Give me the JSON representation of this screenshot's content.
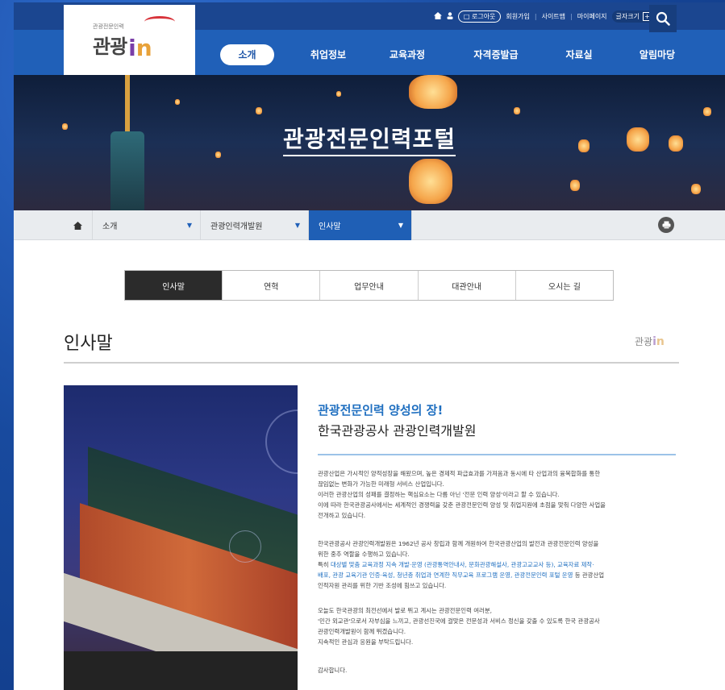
{
  "logo": {
    "small_text": "관광전문인력",
    "korean": "관광",
    "in_i": "i",
    "in_n": "n"
  },
  "util_nav": {
    "home_icon": "home-icon",
    "logout": "로그아웃",
    "join": "회원가입",
    "sitemap": "사이트맵",
    "mypage": "마이페이지",
    "font_size_label": "글자크기",
    "font_plus": "+",
    "font_reset": "o",
    "font_minus": "−"
  },
  "gnb": {
    "items": [
      {
        "label": "소개"
      },
      {
        "label": "취업정보"
      },
      {
        "label": "교육과정"
      },
      {
        "label": "자격증발급"
      },
      {
        "label": "자료실"
      },
      {
        "label": "알림마당"
      }
    ]
  },
  "hero": {
    "title": "관광전문인력포털"
  },
  "breadcrumb": {
    "level1": "소개",
    "level2": "관광인력개발원",
    "level3": "인사말"
  },
  "subtabs": [
    {
      "label": "인사말"
    },
    {
      "label": "연혁"
    },
    {
      "label": "업무안내"
    },
    {
      "label": "대관안내"
    },
    {
      "label": "오시는 길"
    }
  ],
  "page": {
    "title": "인사말",
    "title_logo_kor": "관광"
  },
  "content": {
    "headline1": "관광전문인력 양성의 장!",
    "headline2": "한국관광공사 관광인력개발원",
    "p1": [
      "관광산업은 가시적인 양적성장을 해왔으며, 높은 경제적 파급효과를 가져옴과 동시에 타 산업과의 융복합화를 통한",
      "끊임없는 변화가 가능한 미래형 서비스 산업입니다.",
      "이러한 관광산업의 성패를 결정하는 핵심요소는 다름 아닌 '전문 인력 양성'이라고 할 수 있습니다.",
      "이에 따라 한국관광공사에서는 세계적인 경쟁력을 갖춘 관광전문인력 양성 및 취업지원에 초점을 맞춰 다양한 사업을",
      "전개하고 있습니다."
    ],
    "p2_line1": "한국관광공사 관광인력개발원은 1962년 공사 창립과 함께 개원하여 한국관광산업의 발전과 관광전문인력 양성을",
    "p2_line2": "위한 중추 역할을 수행하고 있습니다.",
    "p2_line3_pre": "특히 ",
    "p2_line3_hl": "대상별 맞춤 교육과정 지속 개발·운영 (관광통역안내사, 문화관광해설사, 관광고교교사 등), 교육자료 제작·",
    "p2_line4_hl": "배포, 관광 교육기관 인증·육성, 청년층 취업과 연계한 직무교육 프로그램 운영, 관광전문인력 포털 운영",
    "p2_line4_post": " 등 관광산업",
    "p2_line5": "인적자원 관리를 위한 기반 조성에 힘쓰고 있습니다.",
    "p3": [
      "오늘도 한국관광의 최전선에서 발로 뛰고 계시는 관광전문인력 여러분,",
      "'민간 외교관'으로서 자부심을 느끼고, 관광선진국에 걸맞은 전문성과 서비스 정신을 갖출 수 있도록 한국 관광공사",
      "관광인력개발원이 함께 뛰겠습니다.",
      "지속적인 관심과 응원을 부탁드립니다."
    ],
    "closing": "감사합니다."
  },
  "colors": {
    "brand_blue": "#2060b8",
    "dark_blue": "#1b4690",
    "accent_text": "#1f6fc0"
  }
}
